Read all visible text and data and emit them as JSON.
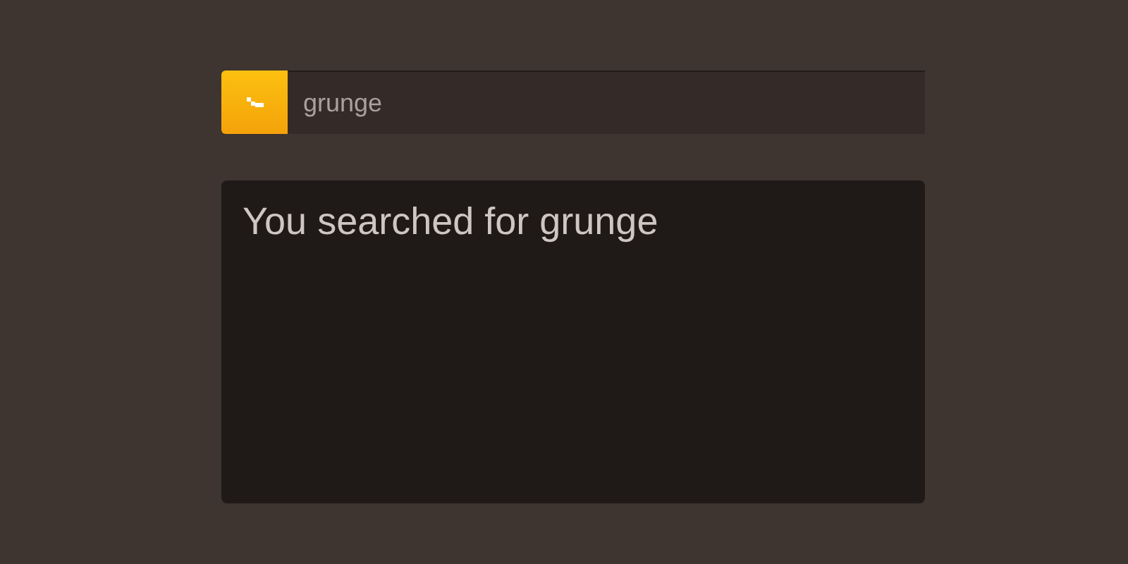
{
  "search": {
    "value": "grunge"
  },
  "result": {
    "text": "You searched for grunge"
  }
}
